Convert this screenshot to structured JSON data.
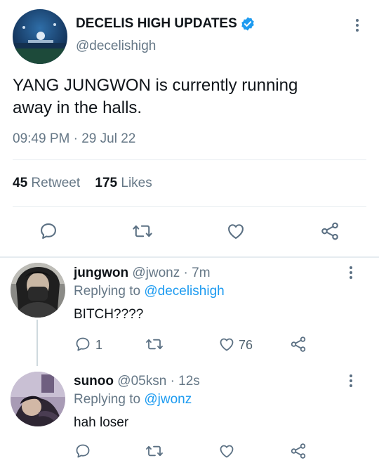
{
  "tweet": {
    "display_name": "DECELIS HIGH UPDATES",
    "handle": "@decelishigh",
    "text_line1": "YANG JUNGWON is currently running",
    "text_line2": "away in the halls.",
    "time": "09:49 PM",
    "date": "29 Jul 22",
    "retweet_count": "45",
    "retweet_label": "Retweet",
    "likes_count": "175",
    "likes_label": "Likes"
  },
  "replies": [
    {
      "display_name": "jungwon",
      "handle": "@jwonz",
      "time_ago": "7m",
      "replying_label": "Replying to",
      "replying_to": "@decelishigh",
      "text": "BITCH????",
      "reply_count": "1",
      "like_count": "76"
    },
    {
      "display_name": "sunoo",
      "handle": "@05ksn",
      "time_ago": "12s",
      "replying_label": "Replying to",
      "replying_to": "@jwonz",
      "text": "hah loser"
    }
  ],
  "separators": {
    "dot": "·"
  },
  "colors": {
    "accent": "#1d9bf0",
    "muted": "#657786",
    "verified": "#1d9bf0"
  },
  "icons": [
    "verified-badge-icon",
    "more-vertical-icon",
    "reply-icon",
    "retweet-icon",
    "like-icon",
    "share-icon"
  ]
}
